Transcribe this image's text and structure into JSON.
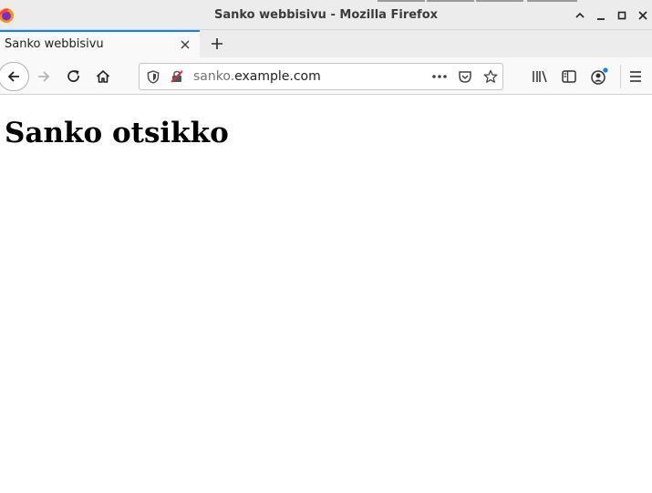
{
  "window": {
    "title": "Sanko webbisivu - Mozilla Firefox"
  },
  "tabs": [
    {
      "label": "Sanko webbisivu",
      "active": true
    }
  ],
  "urlbar": {
    "subdomain": "sanko.",
    "domain": "example.com"
  },
  "page": {
    "heading": "Sanko otsikko"
  },
  "colors": {
    "accent": "#0a84ff",
    "chrome": "#ececec",
    "toolbar": "#f9f9f9"
  },
  "icons": [
    "firefox-logo",
    "minimize-icon",
    "maximize-icon",
    "close-icon",
    "back-icon",
    "forward-icon",
    "reload-icon",
    "home-icon",
    "shield-icon",
    "insecure-lock-icon",
    "page-actions-icon",
    "pocket-icon",
    "bookmark-star-icon",
    "library-icon",
    "sidebar-icon",
    "account-icon",
    "menu-icon",
    "new-tab-icon"
  ]
}
